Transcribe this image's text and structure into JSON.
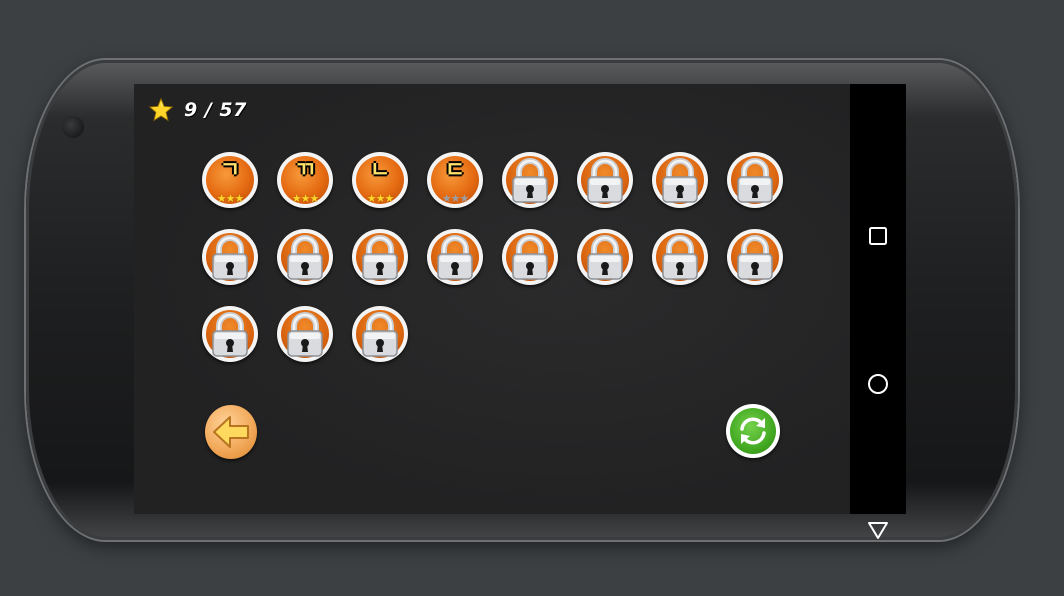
{
  "hud": {
    "stars_label": "9 / 57",
    "star_icon": "star-icon"
  },
  "levels": [
    {
      "glyph": "ㄱ",
      "locked": false,
      "stars": 3
    },
    {
      "glyph": "ㄲ",
      "locked": false,
      "stars": 3
    },
    {
      "glyph": "ㄴ",
      "locked": false,
      "stars": 3
    },
    {
      "glyph": "ㄷ",
      "locked": false,
      "stars": 0
    },
    {
      "glyph": "",
      "locked": true,
      "stars": 0
    },
    {
      "glyph": "",
      "locked": true,
      "stars": 0
    },
    {
      "glyph": "",
      "locked": true,
      "stars": 0
    },
    {
      "glyph": "",
      "locked": true,
      "stars": 0
    },
    {
      "glyph": "",
      "locked": true,
      "stars": 0
    },
    {
      "glyph": "",
      "locked": true,
      "stars": 0
    },
    {
      "glyph": "",
      "locked": true,
      "stars": 0
    },
    {
      "glyph": "",
      "locked": true,
      "stars": 0
    },
    {
      "glyph": "",
      "locked": true,
      "stars": 0
    },
    {
      "glyph": "",
      "locked": true,
      "stars": 0
    },
    {
      "glyph": "",
      "locked": true,
      "stars": 0
    },
    {
      "glyph": "",
      "locked": true,
      "stars": 0
    },
    {
      "glyph": "",
      "locked": true,
      "stars": 0
    },
    {
      "glyph": "",
      "locked": true,
      "stars": 0
    },
    {
      "glyph": "",
      "locked": true,
      "stars": 0
    }
  ],
  "buttons": {
    "back_icon": "arrow-left-icon",
    "reset_icon": "refresh-icon"
  },
  "navbar": {
    "items": [
      "overview-square-icon",
      "home-circle-icon",
      "back-triangle-icon"
    ]
  },
  "colors": {
    "accent_orange": "#e56a12",
    "star_gold": "#ffd52a",
    "reset_green": "#3fa51f",
    "back_orange": "#f2a95a",
    "screen_bg": "#252526"
  }
}
